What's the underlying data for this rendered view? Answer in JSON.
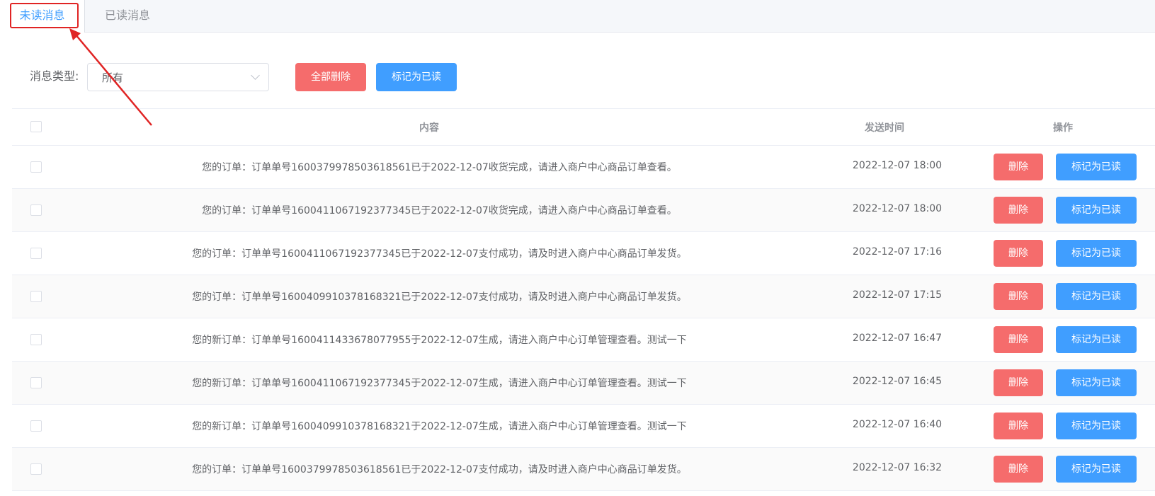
{
  "tabs": [
    {
      "label": "未读消息",
      "active": true
    },
    {
      "label": "已读消息",
      "active": false
    }
  ],
  "filter": {
    "label": "消息类型:",
    "selected": "所有"
  },
  "toolbar": {
    "delete_all_label": "全部删除",
    "mark_read_label": "标记为已读"
  },
  "table": {
    "columns": [
      "内容",
      "发送时间",
      "操作"
    ],
    "rows": [
      {
        "content": "您的订单：订单单号1600379978503618561已于2022-12-07收货完成，请进入商户中心商品订单查看。",
        "time": "2022-12-07 18:00"
      },
      {
        "content": "您的订单：订单单号1600411067192377345已于2022-12-07收货完成，请进入商户中心商品订单查看。",
        "time": "2022-12-07 18:00"
      },
      {
        "content": "您的订单：订单单号1600411067192377345已于2022-12-07支付成功，请及时进入商户中心商品订单发货。",
        "time": "2022-12-07 17:16"
      },
      {
        "content": "您的订单：订单单号1600409910378168321已于2022-12-07支付成功，请及时进入商户中心商品订单发货。",
        "time": "2022-12-07 17:15"
      },
      {
        "content": "您的新订单：订单单号1600411433678077955于2022-12-07生成，请进入商户中心订单管理查看。测试一下",
        "time": "2022-12-07 16:47"
      },
      {
        "content": "您的新订单：订单单号1600411067192377345于2022-12-07生成，请进入商户中心订单管理查看。测试一下",
        "time": "2022-12-07 16:45"
      },
      {
        "content": "您的新订单：订单单号1600409910378168321于2022-12-07生成，请进入商户中心订单管理查看。测试一下",
        "time": "2022-12-07 16:40"
      },
      {
        "content": "您的订单：订单单号1600379978503618561已于2022-12-07支付成功，请及时进入商户中心商品订单发货。",
        "time": "2022-12-07 16:32"
      }
    ],
    "row_actions": {
      "delete_label": "删除",
      "mark_read_label": "标记为已读"
    }
  },
  "colors": {
    "primary": "#409eff",
    "danger": "#f56c6c",
    "annotation": "#e02424"
  }
}
